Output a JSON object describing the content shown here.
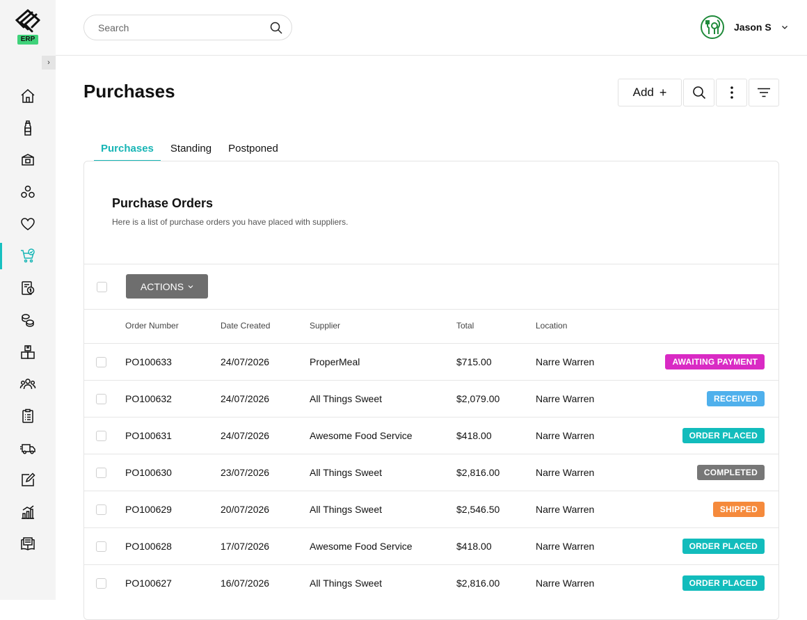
{
  "brand": {
    "badge": "ERP"
  },
  "header": {
    "search_placeholder": "Search",
    "user_name": "Jason S"
  },
  "page": {
    "title": "Purchases",
    "add_label": "Add",
    "add_plus": "+"
  },
  "tabs": [
    {
      "label": "Purchases",
      "active": true
    },
    {
      "label": "Standing",
      "active": false
    },
    {
      "label": "Postponed",
      "active": false
    }
  ],
  "card": {
    "title": "Purchase Orders",
    "subtitle": "Here is a list of purchase orders you have placed with suppliers.",
    "actions_label": "ACTIONS"
  },
  "table": {
    "columns": [
      "Order Number",
      "Date Created",
      "Supplier",
      "Total",
      "Location"
    ],
    "rows": [
      {
        "order": "PO100633",
        "date": "24/07/2026",
        "supplier": "ProperMeal",
        "total": "$715.00",
        "location": "Narre Warren",
        "status": "AWAITING PAYMENT",
        "status_color": "#d92ac4"
      },
      {
        "order": "PO100632",
        "date": "24/07/2026",
        "supplier": "All Things Sweet",
        "total": "$2,079.00",
        "location": "Narre Warren",
        "status": "RECEIVED",
        "status_color": "#4fb0ec"
      },
      {
        "order": "PO100631",
        "date": "24/07/2026",
        "supplier": "Awesome Food Service",
        "total": "$418.00",
        "location": "Narre Warren",
        "status": "ORDER PLACED",
        "status_color": "#12bcbc"
      },
      {
        "order": "PO100630",
        "date": "23/07/2026",
        "supplier": "All Things Sweet",
        "total": "$2,816.00",
        "location": "Narre Warren",
        "status": "COMPLETED",
        "status_color": "#777777"
      },
      {
        "order": "PO100629",
        "date": "20/07/2026",
        "supplier": "All Things Sweet",
        "total": "$2,546.50",
        "location": "Narre Warren",
        "status": "SHIPPED",
        "status_color": "#f58a3c"
      },
      {
        "order": "PO100628",
        "date": "17/07/2026",
        "supplier": "Awesome Food Service",
        "total": "$418.00",
        "location": "Narre Warren",
        "status": "ORDER PLACED",
        "status_color": "#12bcbc"
      },
      {
        "order": "PO100627",
        "date": "16/07/2026",
        "supplier": "All Things Sweet",
        "total": "$2,816.00",
        "location": "Narre Warren",
        "status": "ORDER PLACED",
        "status_color": "#12bcbc"
      }
    ]
  },
  "sidebar": {
    "items": [
      {
        "icon": "home-icon"
      },
      {
        "icon": "bottle-icon"
      },
      {
        "icon": "box-icon"
      },
      {
        "icon": "people-group-icon"
      },
      {
        "icon": "heart-icon"
      },
      {
        "icon": "cart-check-icon",
        "active": true
      },
      {
        "icon": "invoice-dollar-icon"
      },
      {
        "icon": "coins-icon"
      },
      {
        "icon": "boxes-stack-icon"
      },
      {
        "icon": "users-icon"
      },
      {
        "icon": "clipboard-list-icon"
      },
      {
        "icon": "delivery-truck-icon"
      },
      {
        "icon": "edit-icon"
      },
      {
        "icon": "chart-icon"
      },
      {
        "icon": "book-icon"
      }
    ]
  },
  "colors": {
    "accent": "#17b5b5",
    "sidebar_bg": "#f4f4f4"
  }
}
